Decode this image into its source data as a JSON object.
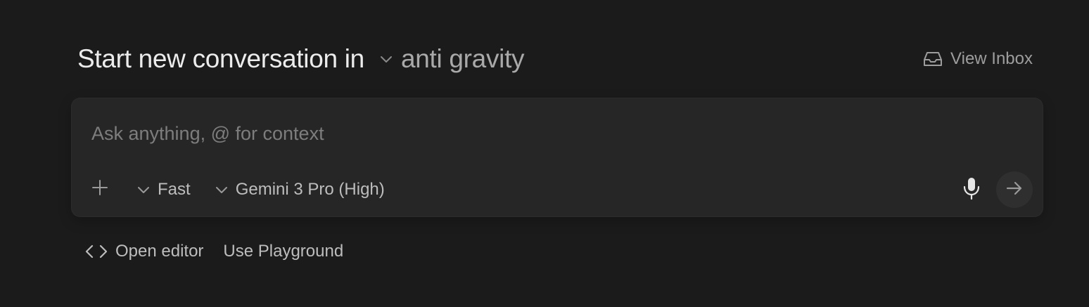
{
  "header": {
    "title": "Start new conversation in",
    "workspace": "anti gravity",
    "view_inbox_label": "View Inbox"
  },
  "composer": {
    "placeholder": "Ask anything, @ for context",
    "value": "",
    "mode": "Fast",
    "model": "Gemini 3 Pro (High)"
  },
  "links": {
    "open_editor": "Open editor",
    "use_playground": "Use Playground"
  },
  "icons": {
    "workspace_chevron": "chevron-down-icon",
    "inbox": "inbox-icon",
    "add": "plus-icon",
    "mode_chevron": "chevron-down-icon",
    "model_chevron": "chevron-down-icon",
    "mic": "microphone-icon",
    "send": "arrow-right-icon",
    "editor": "code-brackets-icon"
  },
  "colors": {
    "background": "#1b1b1b",
    "composer_background": "#262626",
    "send_button_background": "#2f2f2f"
  }
}
